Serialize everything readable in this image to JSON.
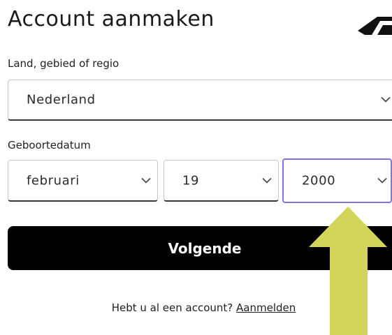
{
  "page": {
    "title": "Account aanmaken"
  },
  "country_field": {
    "label": "Land, gebied of regio",
    "value": "Nederland"
  },
  "birthdate_field": {
    "label": "Geboortedatum",
    "month": "februari",
    "day": "19",
    "year": "2000"
  },
  "actions": {
    "next_label": "Volgende"
  },
  "signin": {
    "prompt": "Hebt u al een account?",
    "link_label": "Aanmelden"
  },
  "colors": {
    "focus_border": "#7f74e6",
    "arrow_fill": "#d2d559",
    "button_bg": "#000000"
  },
  "icons": {
    "logo": "brand-logo",
    "chevron": "chevron-down-icon",
    "annotation": "arrow-up-icon"
  }
}
